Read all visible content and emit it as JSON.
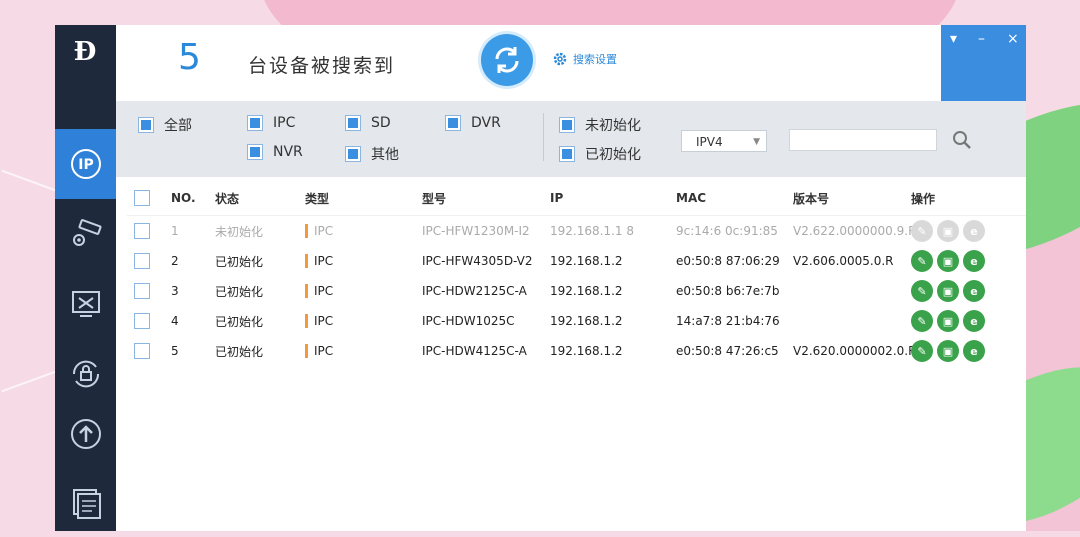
{
  "header": {
    "count": "5",
    "count_label": "台设备被搜索到",
    "settings_label": "搜索设置"
  },
  "window_controls": {
    "pin": "▾",
    "minimize": "–",
    "close": "×"
  },
  "filters": {
    "all": "全部",
    "ipc": "IPC",
    "sd": "SD",
    "dvr": "DVR",
    "nvr": "NVR",
    "other": "其他",
    "uninit": "未初始化",
    "init": "已初始化",
    "ip_version": "IPV4",
    "search_placeholder": ""
  },
  "table": {
    "headers": {
      "no": "NO.",
      "state": "状态",
      "type": "类型",
      "model": "型号",
      "ip": "IP",
      "mac": "MAC",
      "version": "版本号",
      "ops": "操作"
    },
    "rows": [
      {
        "no": "1",
        "state": "未初始化",
        "type": "IPC",
        "model": "IPC-HFW1230M-I2",
        "ip": "192.168.1.1 8",
        "mac": "9c:14:6 0c:91:85",
        "version": "V2.622.0000000.9.R"
      },
      {
        "no": "2",
        "state": "已初始化",
        "type": "IPC",
        "model": "IPC-HFW4305D-V2",
        "ip": "192.168.1.2",
        "mac": "e0:50:8 87:06:29",
        "version": "V2.606.0005.0.R"
      },
      {
        "no": "3",
        "state": "已初始化",
        "type": "IPC",
        "model": "IPC-HDW2125C-A",
        "ip": "192.168.1.2",
        "mac": "e0:50:8 b6:7e:7b",
        "version": ""
      },
      {
        "no": "4",
        "state": "已初始化",
        "type": "IPC",
        "model": "IPC-HDW1025C",
        "ip": "192.168.1.2",
        "mac": "14:a7:8 21:b4:76",
        "version": ""
      },
      {
        "no": "5",
        "state": "已初始化",
        "type": "IPC",
        "model": "IPC-HDW4125C-A",
        "ip": "192.168.1.2",
        "mac": "e0:50:8 47:26:c5",
        "version": "V2.620.0000002.0.R"
      }
    ]
  },
  "colors": {
    "sidebar": "#1e2a3c",
    "accent": "#2f80d8",
    "op_green": "#3aa24a",
    "type_bar": "#f09a3a"
  },
  "icons": {
    "logo": "ID",
    "nav": [
      "ip-icon",
      "camera-settings-icon",
      "tools-icon",
      "lock-refresh-icon",
      "upgrade-icon",
      "document-icon"
    ],
    "ops": [
      "edit-icon",
      "web-icon",
      "browser-icon"
    ]
  }
}
